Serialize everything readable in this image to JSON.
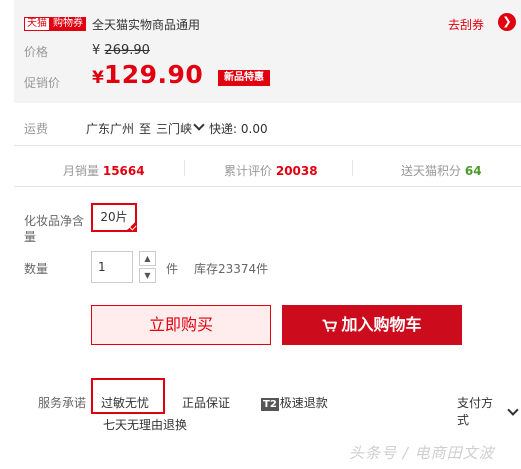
{
  "coupon": {
    "tag_tmall": "天猫",
    "tag_coupon": "购物券",
    "text": "全天猫实物商品通用",
    "link": "去刮券",
    "arrow_icon": "chevron-right-circle-icon"
  },
  "price": {
    "label": "价格",
    "original_symbol": "¥",
    "original_value": "269.90",
    "promo_label": "促销价",
    "promo_symbol": "¥",
    "promo_value": "129.90",
    "promo_badge": "新品特惠"
  },
  "shipping": {
    "label": "运费",
    "from": "广东广州",
    "to_word": "至",
    "to": "三门峡",
    "method": "快递: 0.00"
  },
  "stats": {
    "monthly_sales_label": "月销量",
    "monthly_sales_value": "15664",
    "reviews_label": "累计评价",
    "reviews_value": "20038",
    "points_label": "送天猫积分",
    "points_value": "64"
  },
  "spec": {
    "label": "化妆品净含量",
    "selected_option": "20片"
  },
  "quantity": {
    "label": "数量",
    "value": "1",
    "up": "▲",
    "down": "▼",
    "unit": "件",
    "stock": "库存23374件"
  },
  "actions": {
    "buy_now": "立即购买",
    "add_to_cart": "加入购物车"
  },
  "service": {
    "label": "服务承诺",
    "items": [
      "过敏无忧",
      "正品保证",
      "T2",
      "极速退款"
    ],
    "payment": "支付方式",
    "sub": "七天无理由退换"
  },
  "watermark": "头条号 / 电商田文波",
  "colors": {
    "accent": "#e0000f",
    "cart_button": "#cc0c1c",
    "points_green": "#4c9a2a"
  }
}
